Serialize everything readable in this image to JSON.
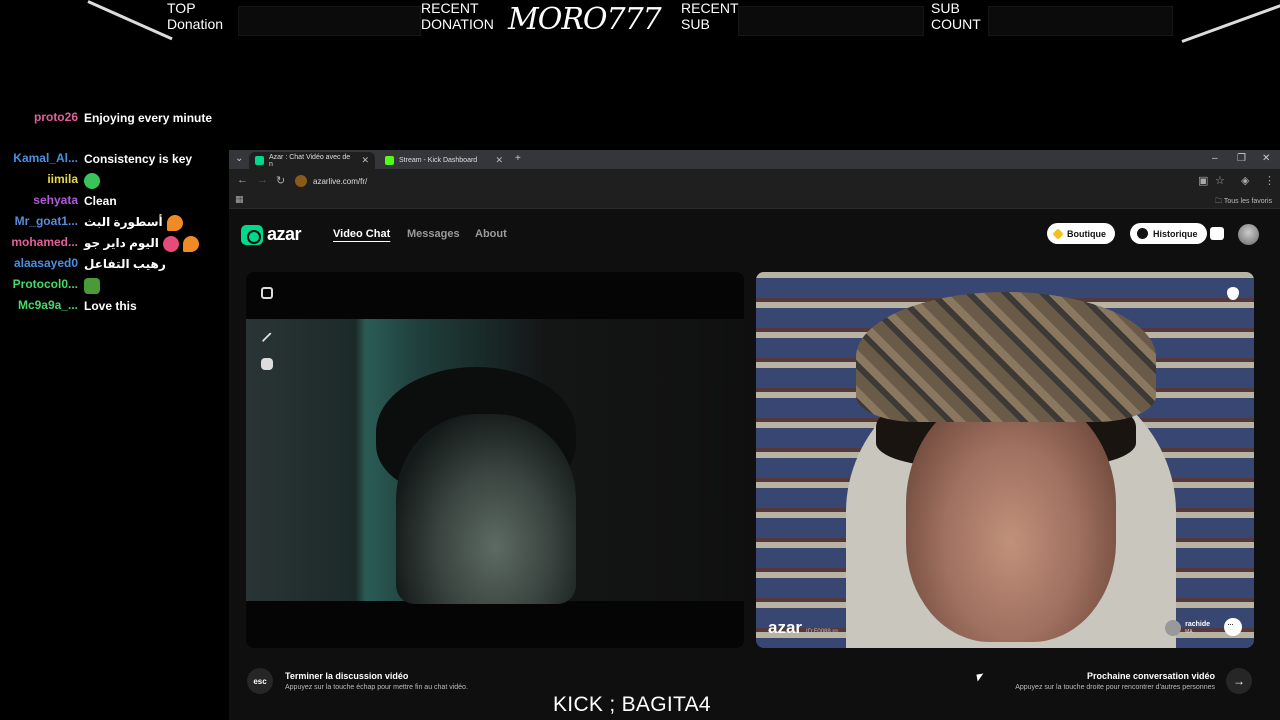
{
  "overlay": {
    "top_donation": "TOP\nDonation",
    "recent_donation": "RECENT\nDONATION",
    "streamer": "MORO777",
    "recent_sub": "RECENT\nSUB",
    "sub_count": "SUB\nCOUNT",
    "caption": "KICK ; BAGITA4"
  },
  "chat": [
    {
      "user": "proto26",
      "color": "#e0609a",
      "message": "Enjoying every minute",
      "emote": ""
    },
    {
      "user": "Kamal_Al...",
      "color": "#4a90e2",
      "message": "Consistency is key",
      "emote": ""
    },
    {
      "user": "iimila",
      "color": "#e8d84a",
      "message": "",
      "emote": "green"
    },
    {
      "user": "sehyata",
      "color": "#b05ad8",
      "message": "Clean",
      "emote": ""
    },
    {
      "user": "Mr_goat1...",
      "color": "#5a8ad8",
      "message": "أسطورة البث",
      "emote": "fire"
    },
    {
      "user": "mohamed...",
      "color": "#e0609a",
      "message": "اليوم داير جو",
      "emote": "love"
    },
    {
      "user": "alaasayed0",
      "color": "#4a90e2",
      "message": "رهيب التفاعل",
      "emote": ""
    },
    {
      "user": "Protocol0...",
      "color": "#4ad86a",
      "message": "",
      "emote": "pepe"
    },
    {
      "user": "Mc9a9a_...",
      "color": "#4ad86a",
      "message": "Love this",
      "emote": ""
    }
  ],
  "browser": {
    "tabs": [
      {
        "title": "Azar : Chat Vidéo avec de n",
        "active": true,
        "favicon_color": "#00d98b"
      },
      {
        "title": "Stream - Kick Dashboard",
        "active": false,
        "favicon_color": "#53fc18"
      }
    ],
    "url": "azarlive.com/fr/",
    "bookmarks_label": "Tous les favoris"
  },
  "site": {
    "logo": "azar",
    "nav": [
      "Video Chat",
      "Messages",
      "About"
    ],
    "boutique": "Boutique",
    "historique": "Historique",
    "watermark": "azar",
    "watermark_id": "ID:F0088.rq",
    "partner_name": "rachide",
    "partner_country": "MA",
    "end_key": "esc",
    "end_title": "Terminer la discussion vidéo",
    "end_sub": "Appuyez sur la touche échap pour mettre fin au chat vidéo.",
    "next_title": "Prochaine conversation vidéo",
    "next_sub": "Appuyez sur la touche droite pour rencontrer d'autres personnes"
  },
  "colors": {
    "brand": "#00d98b",
    "kick": "#53fc18"
  }
}
